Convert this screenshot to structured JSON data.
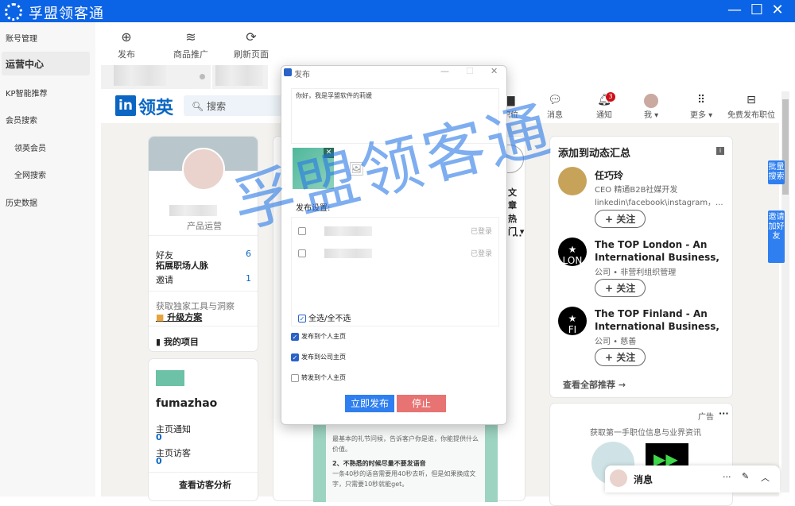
{
  "app": {
    "title": "孚盟领客通",
    "badge": "•"
  },
  "sidebar": {
    "items": [
      {
        "label": "账号管理"
      },
      {
        "label": "运营中心"
      },
      {
        "label": "KP智能推荐"
      },
      {
        "label": "会员搜索"
      },
      {
        "label": "领英会员"
      },
      {
        "label": "全网搜索"
      },
      {
        "label": "历史数据"
      }
    ]
  },
  "toolbar": {
    "publish": "发布",
    "promote": "商品推广",
    "refresh": "刷新页面"
  },
  "linkedin": {
    "logo_in": "in",
    "logo_text": "领英",
    "search_placeholder": "搜索",
    "nav": [
      {
        "label": "职位"
      },
      {
        "label": "消息"
      },
      {
        "label": "通知",
        "badge": "3"
      },
      {
        "label": "我 ▾"
      },
      {
        "label": "更多 ▾"
      },
      {
        "label": "免费发布职位"
      }
    ]
  },
  "profile": {
    "title": "产品运营",
    "friends_label": "好友",
    "friends_sub": "拓展职场人脉",
    "friends_count": "6",
    "invite_label": "邀请",
    "invite_count": "1",
    "tools": "获取独家工具与洞察",
    "upgrade": "升级方案",
    "projects": "我的项目"
  },
  "company": {
    "name": "fumazhao",
    "notif_label": "主页通知",
    "notif_count": "0",
    "visitors_label": "主页访客",
    "visitors_count": "0",
    "analytics": "查看访客分析"
  },
  "feed": {
    "article": "文章",
    "sort": "热门 ▾",
    "more": "···",
    "post_text1": "最基本的礼节问候，告诉客户你是谁，你能提供什么价值。",
    "post_heading": "2、不熟悉的时候尽量不要发语音",
    "post_text2": "一条40秒的语音需要用40秒去听，但是如果换成文字，只需要10秒就能get。"
  },
  "recommend": {
    "title": "添加到动态汇总",
    "items": [
      {
        "name": "任巧玲",
        "sub": "CEO 精通B2B社媒开发",
        "sub2": "linkedin\\facebook\\instagram，...",
        "follow": "+ 关注"
      },
      {
        "name": "The TOP London - An International Business,",
        "logo": "LON",
        "sub": "公司 • 非营利组织管理",
        "follow": "+ 关注"
      },
      {
        "name": "The TOP Finland - An International Business,",
        "logo": "FI",
        "sub": "公司 • 慈善",
        "follow": "+ 关注"
      }
    ],
    "see_all": "查看全部推荐 →"
  },
  "ad": {
    "label": "广告",
    "more": "···",
    "text": "获取第一手职位信息与业界资讯"
  },
  "messaging": {
    "label": "消息"
  },
  "side_buttons": {
    "batch": "批量搜索",
    "invite": "邀请加好友"
  },
  "dialog": {
    "title": "发布",
    "content": "你好，我是孚盟软件的莉媛",
    "settings_label": "发布设置:",
    "accounts": [
      {
        "status": "已登录",
        "checked": true
      },
      {
        "status": "已登录",
        "checked": true
      }
    ],
    "select_all": "全选/全不选",
    "options": [
      {
        "label": "发布到个人主页",
        "checked": true
      },
      {
        "label": "发布到公司主页",
        "checked": true
      },
      {
        "label": "转发到个人主页",
        "checked": false
      }
    ],
    "publish_btn": "立即发布",
    "stop_btn": "停止"
  },
  "watermark": "孚盟领客通",
  "colors": {
    "brand": "#0b63e5",
    "linkedin": "#0a66c2",
    "publish": "#2f7ff0",
    "stop": "#e87373"
  }
}
